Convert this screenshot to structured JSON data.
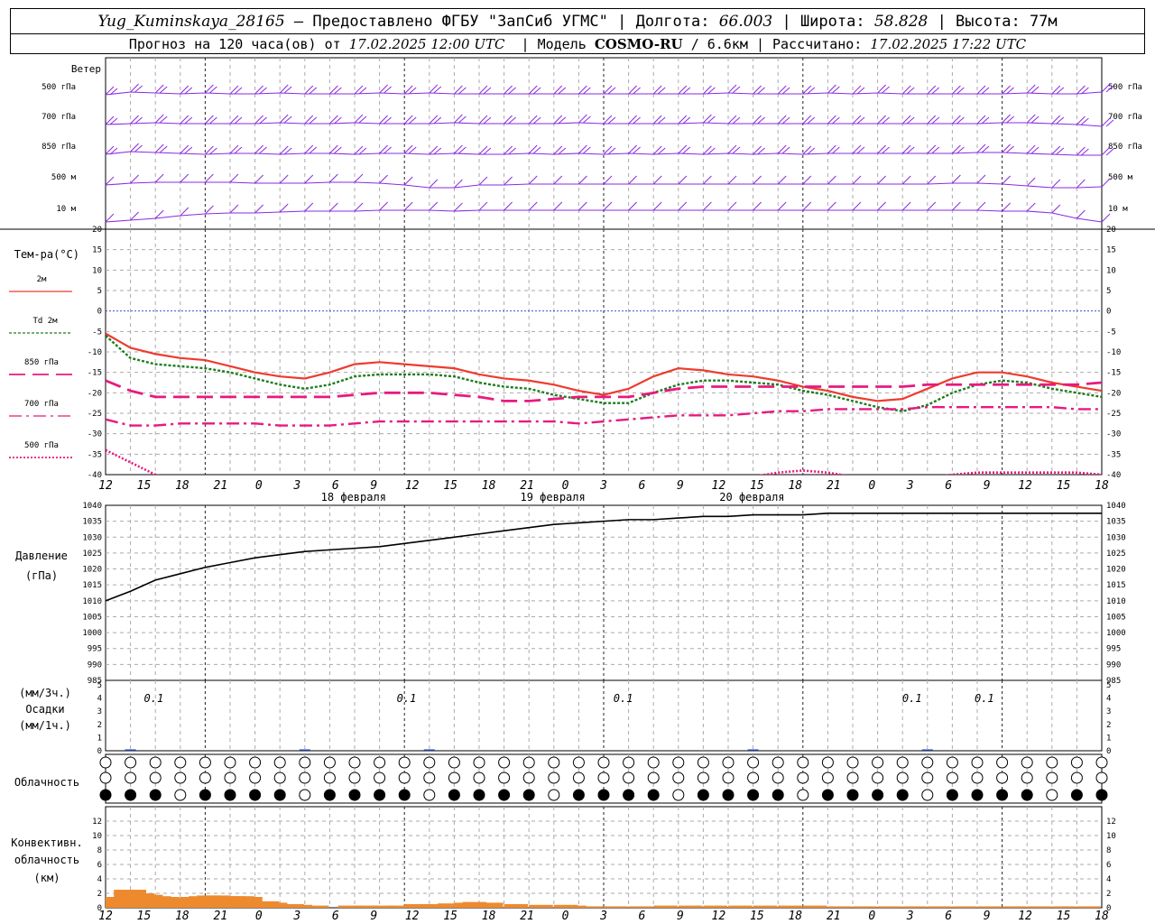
{
  "header": {
    "station": "Yug_Kuminskaya_28165",
    "provider": "— Предоставлено ФГБУ \"ЗапСиб УГМС\" | Долгота:",
    "longitude": "66.003",
    "lat_label": "| Широта:",
    "latitude": "58.828",
    "alt_label": "| Высота:",
    "altitude": "77м",
    "forecast_prefix": "Прогноз на 120 часа(ов) от",
    "forecast_start": "17.02.2025 12:00 UTC",
    "model_label": "| Модель",
    "model": "COSMO-RU",
    "resolution": "/ 6.6км",
    "calc_label": "| Рассчитано:",
    "calc_time": "17.02.2025 17:22 UTC"
  },
  "labels": {
    "wind": "Ветер",
    "wind_levels": [
      "500 гПа",
      "700 гПа",
      "850 гПа",
      "500 м",
      "10  м"
    ],
    "temp_title": "Тем-ра(°С)",
    "temp_series": [
      "2м",
      "Td  2м",
      "850 гПа",
      "700 гПа",
      "500 гПа"
    ],
    "pressure_title": "Давление",
    "pressure_unit": "(гПа)",
    "precip_top": "(мм/3ч.)",
    "precip_title": "Осадки",
    "precip_bottom": "(мм/1ч.)",
    "cloud_title": "Облачность",
    "conv_title": "Конвективн.",
    "conv_sub": "облачность",
    "conv_unit": "(км)"
  },
  "time_axis": {
    "ticks": [
      "12",
      "15",
      "18",
      "21",
      "0",
      "3",
      "6",
      "9",
      "12",
      "15",
      "18",
      "21",
      "0",
      "3",
      "6",
      "9",
      "12",
      "15",
      "18",
      "21",
      "0",
      "3",
      "6",
      "9",
      "12",
      "15",
      "18"
    ],
    "dates": [
      "18 февраля",
      "19 февраля",
      "20 февраля"
    ]
  },
  "colors": {
    "wind": "#8a2be2",
    "t2m": "#ee3b2e",
    "td2m": "#1e7d1e",
    "t850": "#e8197f",
    "t700": "#e8197f",
    "t500": "#e8197f",
    "zero_line": "#3355cc",
    "precip": "#1f3fb0",
    "convective": "#ee8a2e"
  },
  "chart_data": [
    {
      "type": "line",
      "panel": "temperature",
      "ylabel": "Тем-ра(°С)",
      "ylim": [
        -40,
        20
      ],
      "yticks": [
        20,
        15,
        10,
        5,
        0,
        -5,
        -10,
        -15,
        -20,
        -25,
        -30,
        -35,
        -40
      ],
      "x_hours": [
        0,
        3,
        6,
        9,
        12,
        15,
        18,
        21,
        24,
        27,
        30,
        33,
        36,
        39,
        42,
        45,
        48,
        51,
        54,
        57,
        60,
        63,
        66,
        69,
        72,
        75,
        78,
        81,
        84,
        87,
        90,
        93,
        96,
        99,
        102,
        105,
        108,
        111,
        114,
        117,
        120
      ],
      "series": [
        {
          "name": "2м",
          "values": [
            -5.5,
            -9,
            -10.5,
            -11.5,
            -12,
            -13.5,
            -15,
            -16,
            -16.5,
            -15,
            -13,
            -12.5,
            -13,
            -13.5,
            -14,
            -15.5,
            -16.5,
            -17,
            -18,
            -19.5,
            -20.5,
            -19,
            -16,
            -14,
            -14.5,
            -15.5,
            -16,
            -17,
            -18.5,
            -19.5,
            -21,
            -22,
            -21.5,
            -19,
            -16.5,
            -15,
            -15,
            -16,
            -17.5,
            -18.5,
            -19.5
          ]
        },
        {
          "name": "Td  2м",
          "values": [
            -6,
            -11.5,
            -13,
            -13.5,
            -14,
            -15,
            -16.5,
            -18,
            -19,
            -18,
            -16,
            -15.5,
            -15.5,
            -15.5,
            -16,
            -17.5,
            -18.5,
            -19,
            -20.5,
            -21.5,
            -22.5,
            -22.5,
            -20,
            -18,
            -17,
            -17,
            -17.5,
            -18,
            -19.5,
            -20.5,
            -22,
            -23.5,
            -24.5,
            -23,
            -20,
            -18,
            -17,
            -17.5,
            -19,
            -20,
            -21
          ]
        },
        {
          "name": "850 гПа",
          "values": [
            -17,
            -19.5,
            -21,
            -21,
            -21,
            -21,
            -21,
            -21,
            -21,
            -21,
            -20.5,
            -20,
            -20,
            -20,
            -20.5,
            -21,
            -22,
            -22,
            -21.5,
            -21,
            -21,
            -21,
            -20,
            -19,
            -18.5,
            -18.5,
            -18.5,
            -18.5,
            -18.5,
            -18.5,
            -18.5,
            -18.5,
            -18.5,
            -18,
            -18,
            -18,
            -18,
            -18,
            -18,
            -18,
            -17.5
          ]
        },
        {
          "name": "700 гПа",
          "values": [
            -26.5,
            -28,
            -28,
            -27.5,
            -27.5,
            -27.5,
            -27.5,
            -28,
            -28,
            -28,
            -27.5,
            -27,
            -27,
            -27,
            -27,
            -27,
            -27,
            -27,
            -27,
            -27.5,
            -27,
            -26.5,
            -26,
            -25.5,
            -25.5,
            -25.5,
            -25,
            -24.5,
            -24.5,
            -24,
            -24,
            -24,
            -24,
            -23.5,
            -23.5,
            -23.5,
            -23.5,
            -23.5,
            -23.5,
            -24,
            -24
          ]
        },
        {
          "name": "500 гПа",
          "values": [
            -34,
            -37,
            -40,
            -42,
            -43,
            -43,
            -43,
            -43,
            -43,
            -43,
            -43,
            -43,
            -43,
            -43,
            -43,
            -43,
            -43,
            -43,
            -43,
            -43,
            -43,
            -43,
            -43,
            -43,
            -43,
            -43,
            -40.5,
            -39.5,
            -39,
            -39.5,
            -40.5,
            -42,
            -42,
            -41,
            -40,
            -39.5,
            -39.5,
            -39.5,
            -39.5,
            -39.5,
            -40
          ]
        }
      ]
    },
    {
      "type": "line",
      "panel": "pressure",
      "ylabel": "Давление (гПа)",
      "ylim": [
        985,
        1040
      ],
      "yticks": [
        1040,
        1035,
        1030,
        1025,
        1020,
        1015,
        1010,
        1005,
        1000,
        995,
        990,
        985
      ],
      "x_hours": [
        0,
        3,
        6,
        9,
        12,
        15,
        18,
        21,
        24,
        27,
        30,
        33,
        36,
        39,
        42,
        45,
        48,
        51,
        54,
        57,
        60,
        63,
        66,
        69,
        72,
        75,
        78,
        81,
        84,
        87,
        90,
        93,
        96,
        99,
        102,
        105,
        108,
        111,
        114,
        117,
        120
      ],
      "series": [
        {
          "name": "",
          "values": [
            1010,
            1013,
            1016.5,
            1018.5,
            1020.5,
            1022,
            1023.5,
            1024.5,
            1025.5,
            1026,
            1026.5,
            1027,
            1028,
            1029,
            1030,
            1031,
            1032,
            1033,
            1034,
            1034.5,
            1035,
            1035.5,
            1035.5,
            1036,
            1036.5,
            1036.5,
            1037,
            1037,
            1037,
            1037.5,
            1037.5,
            1037.5,
            1037.5,
            1037.5,
            1037.5,
            1037.5,
            1037.5,
            1037.5,
            1037.5,
            1037.5,
            1037.5
          ]
        }
      ]
    },
    {
      "type": "bar",
      "panel": "precipitation",
      "ylabel": "Осадки (мм/3ч.) (мм/1ч.)",
      "ylim": [
        0,
        5
      ],
      "yticks": [
        5,
        4,
        3,
        2,
        1,
        0
      ],
      "x_hours": [
        3,
        24,
        39,
        78,
        99
      ],
      "values": [
        0.1,
        0.0,
        0.1,
        0.1,
        0.1
      ],
      "annotations": [
        {
          "hour": 4,
          "text": "0.1"
        },
        {
          "hour": 25,
          "text": "0.1"
        },
        {
          "hour": 43,
          "text": "0.1"
        },
        {
          "hour": 67,
          "text": "0.1"
        },
        {
          "hour": 73,
          "text": "0.1"
        }
      ]
    },
    {
      "type": "bar",
      "panel": "convective",
      "ylabel": "Конвективн. облачность (км)",
      "ylim": [
        0,
        14
      ],
      "yticks": [
        12,
        10,
        8,
        6,
        4,
        2,
        0
      ],
      "x_hours": [
        0,
        1,
        2,
        3,
        4,
        5,
        6,
        7,
        8,
        9,
        10,
        11,
        12,
        13,
        14,
        15,
        16,
        18,
        19,
        20,
        21,
        22,
        24,
        28,
        30,
        32,
        34,
        36,
        38,
        40,
        42,
        43,
        45,
        48,
        51,
        54,
        55,
        57,
        60,
        63,
        66,
        69,
        72,
        75,
        78,
        81,
        84,
        87,
        90,
        93,
        96,
        99,
        102,
        105,
        108,
        111,
        114,
        117
      ],
      "values": [
        1.5,
        2.5,
        2.5,
        2,
        1.8,
        1.6,
        1.5,
        1.4,
        1.4,
        1.5,
        1.6,
        1.7,
        1.7,
        1.6,
        1.6,
        1.6,
        1.5,
        0.9,
        0.7,
        0.5,
        0.5,
        0.4,
        0.3,
        0.3,
        0.3,
        0.3,
        0.3,
        0.5,
        0.5,
        0.6,
        0.7,
        0.8,
        0.7,
        0.5,
        0.4,
        0.4,
        0.3,
        0.2,
        0.2,
        0.2,
        0.3,
        0.3,
        0.3,
        0.3,
        0.3,
        0.3,
        0.3,
        0.2,
        0.2,
        0.2,
        0.2,
        0.2,
        0.2,
        0.2,
        0.2,
        0.2,
        0.2,
        0.2
      ]
    }
  ],
  "clouds": {
    "low": "2222222222222222222222222222222222222222222222222222222222222222222222222222222222222222222222222222222222",
    "mid": "0000000000000000000000000000000000000000000000000000000000000000000000000000000000000000000000000000000000000000000000000000",
    "high": "0000000000000000000000000000000000000000000000000000000000000000000000000000000000000000000000000000000000000000000000000000"
  }
}
